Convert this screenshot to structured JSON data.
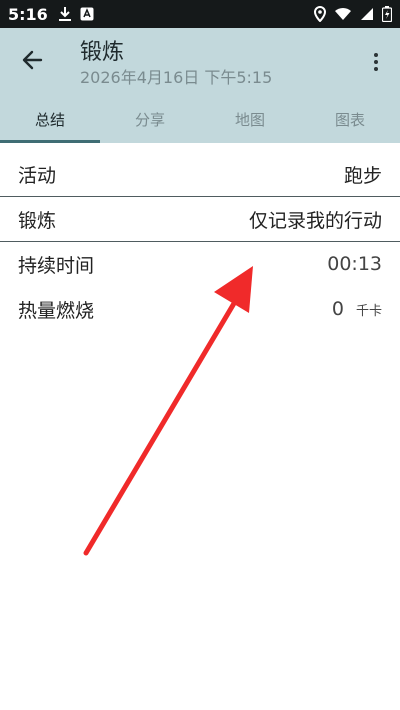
{
  "status_bar": {
    "time": "5:16"
  },
  "header": {
    "title": "锻炼",
    "subtitle": "2026年4月16日 下午5:15"
  },
  "tabs": [
    {
      "label": "总结",
      "active": true
    },
    {
      "label": "分享",
      "active": false
    },
    {
      "label": "地图",
      "active": false
    },
    {
      "label": "图表",
      "active": false
    }
  ],
  "details": {
    "activity": {
      "label": "活动",
      "value": "跑步"
    },
    "workout": {
      "label": "锻炼",
      "value": "仅记录我的行动"
    },
    "duration": {
      "label": "持续时间",
      "value": "00:13"
    },
    "calories": {
      "label": "热量燃烧",
      "value": "0",
      "unit": "千卡"
    }
  },
  "icons": {
    "back": "arrow-left-icon",
    "more": "more-vert-icon"
  },
  "colors": {
    "app_bar": "#c2d8dc",
    "tab_indicator": "#3f6d74",
    "annotation_arrow": "#f02a2a"
  }
}
